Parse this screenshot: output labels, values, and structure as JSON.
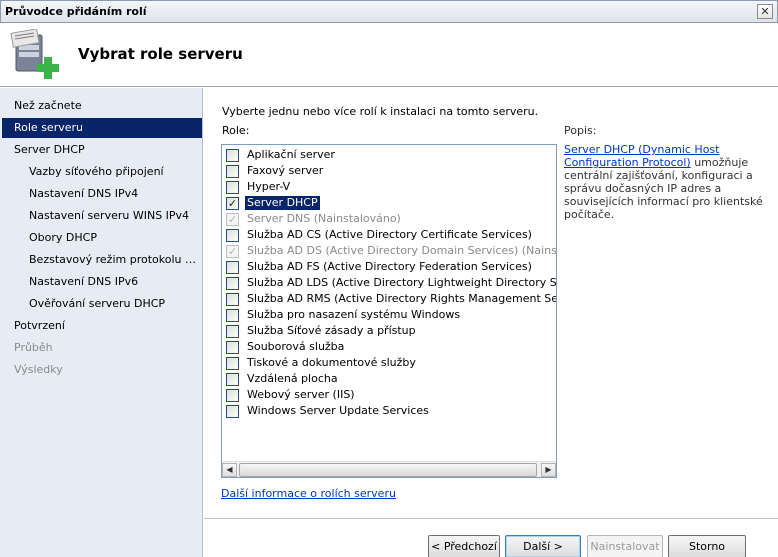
{
  "window": {
    "title": "Průvodce přidáním rolí",
    "close_label": "✕"
  },
  "header": {
    "title": "Vybrat role serveru"
  },
  "sidebar": {
    "items": [
      {
        "label": "Než začnete",
        "state": "normal",
        "level": 0
      },
      {
        "label": "Role serveru",
        "state": "active",
        "level": 0
      },
      {
        "label": "Server DHCP",
        "state": "normal",
        "level": 0
      },
      {
        "label": "Vazby síťového připojení",
        "state": "normal",
        "level": 1
      },
      {
        "label": "Nastavení DNS IPv4",
        "state": "normal",
        "level": 1
      },
      {
        "label": "Nastavení serveru WINS IPv4",
        "state": "normal",
        "level": 1
      },
      {
        "label": "Obory DHCP",
        "state": "normal",
        "level": 1
      },
      {
        "label": "Bezstavový režim protokolu D...",
        "state": "normal",
        "level": 1
      },
      {
        "label": "Nastavení DNS IPv6",
        "state": "normal",
        "level": 1
      },
      {
        "label": "Ověřování serveru DHCP",
        "state": "normal",
        "level": 1
      },
      {
        "label": "Potvrzení",
        "state": "normal",
        "level": 0
      },
      {
        "label": "Průběh",
        "state": "disabled",
        "level": 0
      },
      {
        "label": "Výsledky",
        "state": "disabled",
        "level": 0
      }
    ]
  },
  "main": {
    "intro": "Vyberte jednu nebo více rolí k instalaci na tomto serveru.",
    "roles_label": "Role:",
    "roles": [
      {
        "label": "Aplikační server",
        "checked": false,
        "disabled": false,
        "selected": false
      },
      {
        "label": "Faxový server",
        "checked": false,
        "disabled": false,
        "selected": false
      },
      {
        "label": "Hyper-V",
        "checked": false,
        "disabled": false,
        "selected": false
      },
      {
        "label": "Server DHCP",
        "checked": true,
        "disabled": false,
        "selected": true
      },
      {
        "label": "Server DNS  (Nainstalováno)",
        "checked": true,
        "disabled": true,
        "selected": false
      },
      {
        "label": "Služba AD CS (Active Directory Certificate Services)",
        "checked": false,
        "disabled": false,
        "selected": false
      },
      {
        "label": "Služba AD DS (Active Directory Domain Services)  (Nainstalováno)",
        "checked": true,
        "disabled": true,
        "selected": false
      },
      {
        "label": "Služba AD FS (Active Directory Federation Services)",
        "checked": false,
        "disabled": false,
        "selected": false
      },
      {
        "label": "Služba AD LDS (Active Directory Lightweight Directory Services)",
        "checked": false,
        "disabled": false,
        "selected": false
      },
      {
        "label": "Služba AD RMS (Active Directory Rights Management Services)",
        "checked": false,
        "disabled": false,
        "selected": false
      },
      {
        "label": "Služba pro nasazení systému Windows",
        "checked": false,
        "disabled": false,
        "selected": false
      },
      {
        "label": "Služba Síťové zásady a přístup",
        "checked": false,
        "disabled": false,
        "selected": false
      },
      {
        "label": "Souborová služba",
        "checked": false,
        "disabled": false,
        "selected": false
      },
      {
        "label": "Tiskové a dokumentové služby",
        "checked": false,
        "disabled": false,
        "selected": false
      },
      {
        "label": "Vzdálená plocha",
        "checked": false,
        "disabled": false,
        "selected": false
      },
      {
        "label": "Webový server (IIS)",
        "checked": false,
        "disabled": false,
        "selected": false
      },
      {
        "label": "Windows Server Update Services",
        "checked": false,
        "disabled": false,
        "selected": false
      }
    ],
    "more_info_link": "Další informace o rolích serveru",
    "description": {
      "label": "Popis:",
      "link": "Server DHCP (Dynamic Host Configuration Protocol)",
      "text": " umožňuje centrální zajišťování, konfiguraci a správu dočasných IP adres a souvisejících informací pro klientské počítače."
    }
  },
  "footer": {
    "back_label": "< Předchozí",
    "next_label": "Další >",
    "install_label": "Nainstalovat",
    "cancel_label": "Storno"
  },
  "icons": {
    "check": "✓",
    "scroll_left": "◀",
    "scroll_right": "▶"
  }
}
